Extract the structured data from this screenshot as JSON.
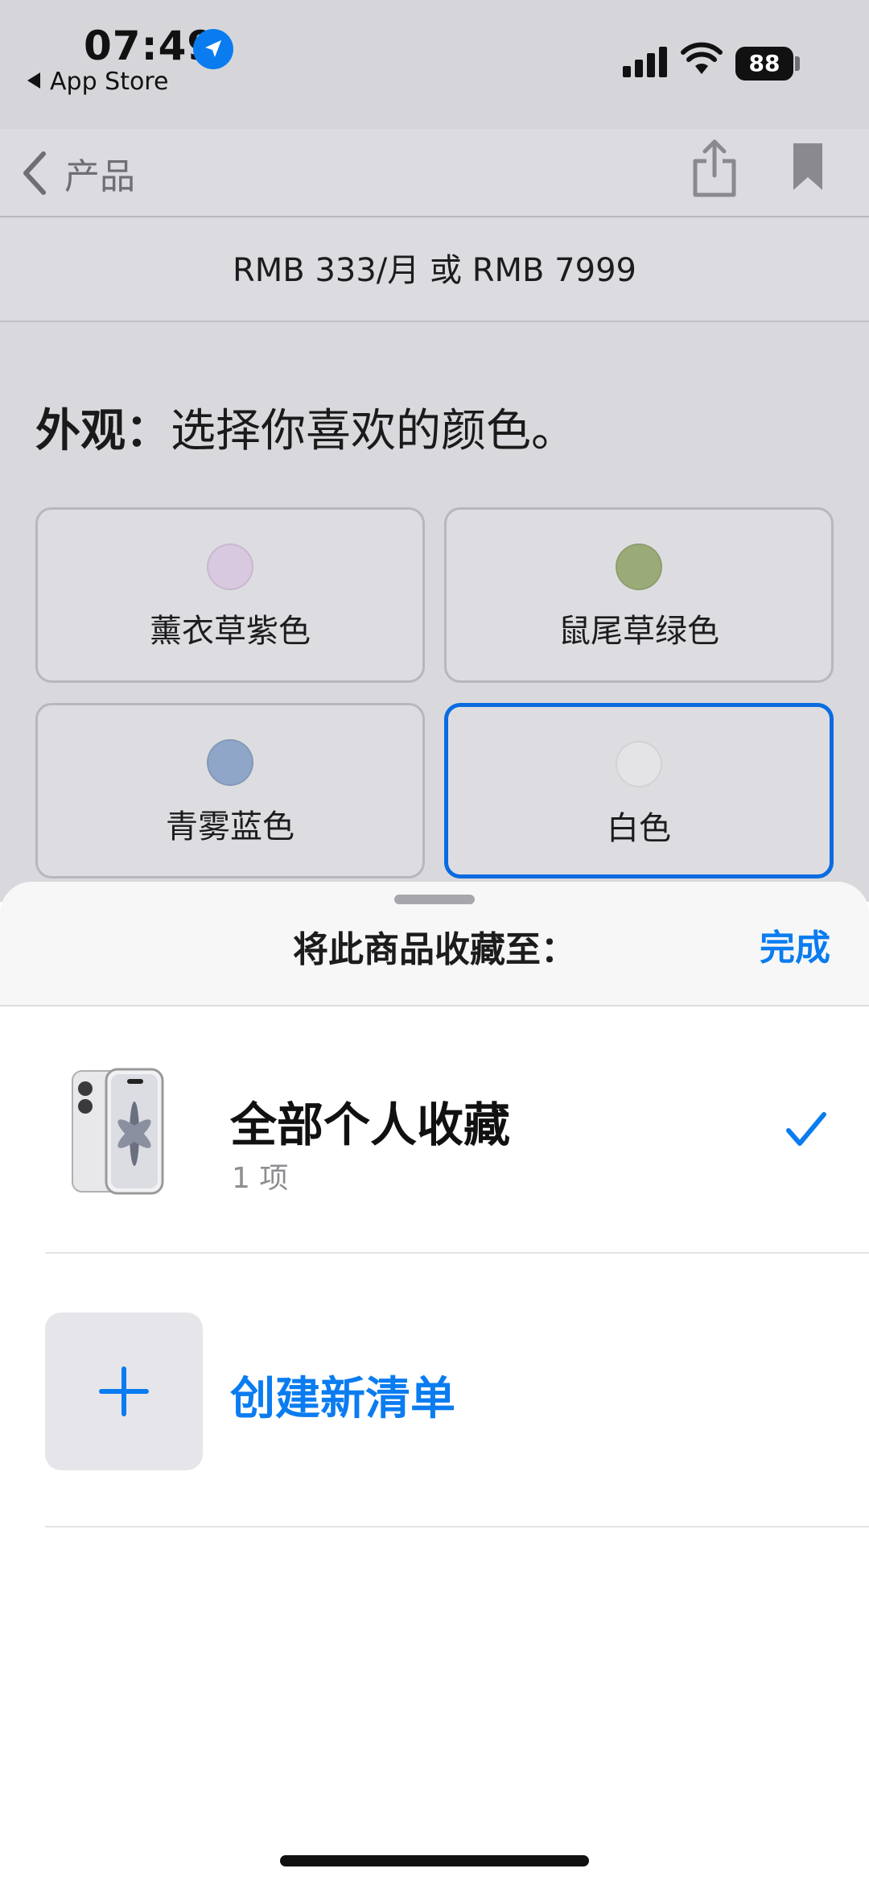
{
  "status_bar": {
    "time": "07:49",
    "back_app": "App Store",
    "battery": "88"
  },
  "nav": {
    "back_label": "产品",
    "share_icon": "share-icon",
    "bookmark_icon": "bookmark-icon"
  },
  "price": "RMB 333/月 或 RMB 7999",
  "appearance": {
    "title_bold": "外观：",
    "title_rest": "选择你喜欢的颜色。"
  },
  "colors": [
    {
      "label": "薰衣草紫色",
      "swatch": "#d8c8e0",
      "selected": false
    },
    {
      "label": "鼠尾草绿色",
      "swatch": "#9aab78",
      "selected": false
    },
    {
      "label": "青雾蓝色",
      "swatch": "#90a6c8",
      "selected": false
    },
    {
      "label": "白色",
      "swatch": "#e4e4e6",
      "selected": true
    }
  ],
  "sheet": {
    "title": "将此商品收藏至：",
    "done": "完成",
    "collections": [
      {
        "name": "全部个人收藏",
        "count": "1 项",
        "checked": true
      }
    ],
    "new_list": "创建新清单"
  },
  "accent_color": "#0a7cf0"
}
